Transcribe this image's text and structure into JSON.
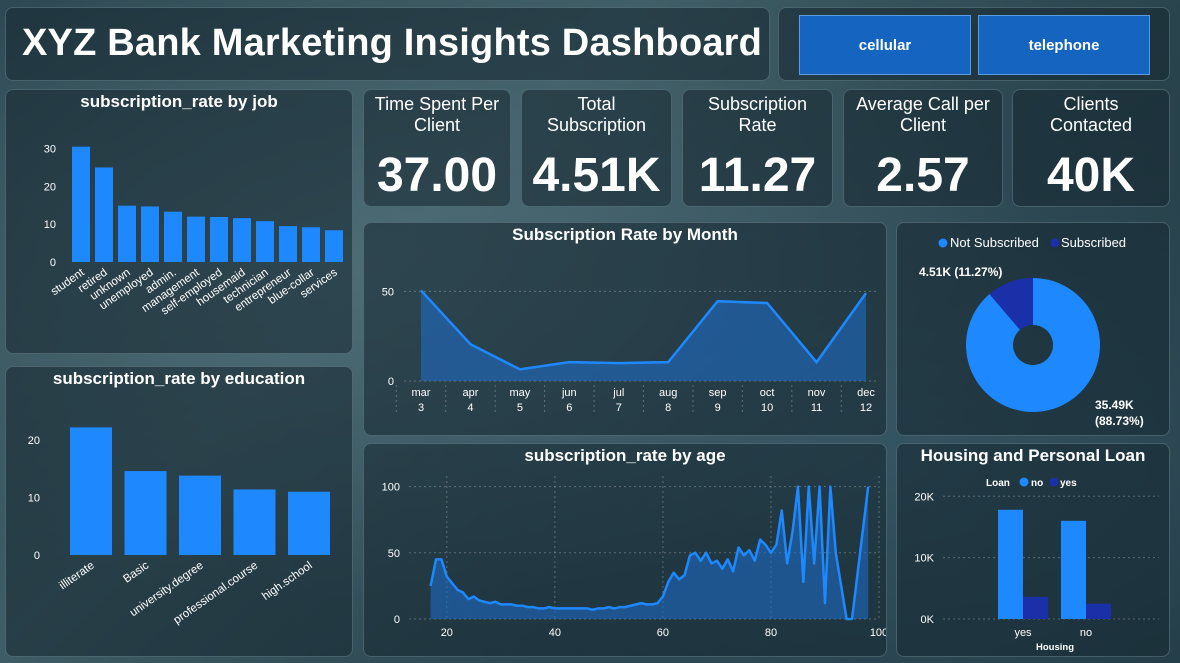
{
  "header": {
    "title": "XYZ Bank Marketing Insights Dashboard"
  },
  "filters": {
    "cellular": "cellular",
    "telephone": "telephone"
  },
  "kpis": {
    "time_spent": {
      "label_line1": "Time Spent Per",
      "label_line2": "Client",
      "value": "37.00"
    },
    "total_subscription": {
      "label_line1": "Total",
      "label_line2": "Subscription",
      "value": "4.51K"
    },
    "subscription_rate": {
      "label_line1": "Subscription",
      "label_line2": "Rate",
      "value": "11.27"
    },
    "avg_call": {
      "label_line1": "Average Call per",
      "label_line2": "Client",
      "value": "2.57"
    },
    "clients": {
      "label_line1": "Clients",
      "label_line2": "Contacted",
      "value": "40K"
    }
  },
  "colors": {
    "bar": "#1e88ff",
    "dark_series": "#1a2fa8",
    "area_fill": "#1e6fd0"
  },
  "chart_data": [
    {
      "id": "job",
      "type": "bar",
      "title": "subscription_rate by job",
      "categories": [
        "student",
        "retired",
        "unknown",
        "unemployed",
        "admin.",
        "management",
        "self-employed",
        "housemaid",
        "technician",
        "entrepreneur",
        "blue-collar",
        "services"
      ],
      "values": [
        30.5,
        25.0,
        14.9,
        14.7,
        13.3,
        12.0,
        11.9,
        11.6,
        10.8,
        9.5,
        9.2,
        8.4
      ],
      "ylim": [
        0,
        32
      ],
      "yticks": [
        "0",
        "10",
        "20",
        "30"
      ]
    },
    {
      "id": "education",
      "type": "bar",
      "title": "subscription_rate by education",
      "categories": [
        "illiterate",
        "Basic",
        "university.degree",
        "professional.course",
        "high.school"
      ],
      "values": [
        22.2,
        14.6,
        13.8,
        11.4,
        11.0
      ],
      "ylim": [
        0,
        24
      ],
      "yticks": [
        "0",
        "10",
        "20"
      ]
    },
    {
      "id": "month",
      "type": "area",
      "title": "Subscription Rate by Month",
      "categories": [
        "mar",
        "apr",
        "may",
        "jun",
        "jul",
        "aug",
        "sep",
        "oct",
        "nov",
        "dec"
      ],
      "month_numbers": [
        "3",
        "4",
        "5",
        "6",
        "7",
        "8",
        "9",
        "10",
        "11",
        "12"
      ],
      "values": [
        50.5,
        20.5,
        6.5,
        10.5,
        10.0,
        10.5,
        44.5,
        43.5,
        10.5,
        49.0
      ],
      "ylim": [
        0,
        58
      ],
      "yticks": [
        "0",
        "50"
      ]
    },
    {
      "id": "donut",
      "type": "pie",
      "legend": [
        "Not Subscribed",
        "Subscribed"
      ],
      "values": [
        88.73,
        11.27
      ],
      "labels": [
        "35.49K",
        "(88.73%)",
        "4.51K (11.27%)"
      ]
    },
    {
      "id": "age",
      "type": "area",
      "title": "subscription_rate by age",
      "x": [
        17,
        18,
        19,
        20,
        21,
        22,
        23,
        24,
        25,
        26,
        27,
        28,
        29,
        30,
        31,
        32,
        33,
        34,
        35,
        36,
        37,
        38,
        39,
        40,
        41,
        42,
        43,
        44,
        45,
        46,
        47,
        48,
        49,
        50,
        51,
        52,
        53,
        54,
        55,
        56,
        57,
        58,
        59,
        60,
        61,
        62,
        63,
        64,
        65,
        66,
        67,
        68,
        69,
        70,
        71,
        72,
        73,
        74,
        75,
        76,
        77,
        78,
        79,
        80,
        81,
        82,
        83,
        84,
        85,
        86,
        87,
        88,
        89,
        90,
        91,
        92,
        94,
        95,
        98
      ],
      "values": [
        25,
        45,
        45,
        32,
        27,
        22,
        20,
        15,
        17,
        14,
        13,
        12,
        13,
        11,
        11,
        11,
        10,
        10,
        9,
        9,
        8,
        8,
        9,
        8,
        8,
        8,
        8,
        8,
        8,
        8,
        7,
        8,
        8,
        9,
        8,
        9,
        9,
        10,
        11,
        12,
        11,
        11,
        12,
        17,
        28,
        35,
        30,
        33,
        48,
        50,
        44,
        50,
        42,
        44,
        38,
        45,
        36,
        54,
        48,
        52,
        44,
        60,
        56,
        50,
        56,
        82,
        42,
        66,
        100,
        28,
        100,
        42,
        100,
        12,
        100,
        50,
        0,
        0,
        100
      ],
      "xlim": [
        13,
        100
      ],
      "ylim": [
        0,
        108
      ],
      "xticks": [
        "20",
        "40",
        "60",
        "80",
        "100"
      ],
      "yticks": [
        "0",
        "50",
        "100"
      ]
    },
    {
      "id": "housing",
      "type": "bar",
      "title": "Housing and Personal Loan",
      "legend_title": "Loan",
      "series": [
        {
          "name": "no",
          "values": [
            17800,
            16000
          ]
        },
        {
          "name": "yes",
          "values": [
            3600,
            2500
          ]
        }
      ],
      "categories": [
        "yes",
        "no"
      ],
      "xlabel": "Housing",
      "ylim": [
        0,
        22000
      ],
      "yticks": [
        "0K",
        "10K",
        "20K"
      ]
    }
  ]
}
